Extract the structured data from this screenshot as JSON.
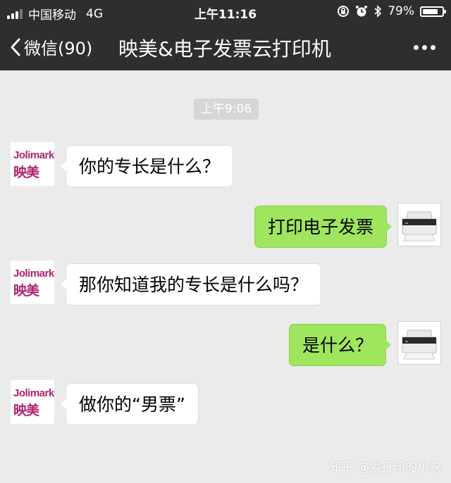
{
  "status_bar": {
    "carrier": "中国移动",
    "network": "4G",
    "time": "上午11:16",
    "battery": "79%",
    "battery_level": 0.79,
    "icons": [
      "signal-icon",
      "rotation-lock-icon",
      "alarm-icon",
      "bluetooth-icon",
      "battery-icon"
    ]
  },
  "nav": {
    "back_label": "微信(90)",
    "title": "映美&电子发票云打印机",
    "more_icon": "more-icon"
  },
  "chat": {
    "timestamp": "上午9:06",
    "avatars": {
      "bot_logo_top": "Jolimark",
      "bot_logo_bottom": "映美",
      "user_avatar": "printer-photo"
    },
    "messages": [
      {
        "side": "left",
        "text": "你的专长是什么？"
      },
      {
        "side": "right",
        "text": "打印电子发票"
      },
      {
        "side": "left",
        "text": "那你知道我的专长是什么吗？"
      },
      {
        "side": "right",
        "text": "是什么？"
      },
      {
        "side": "left",
        "text": "做你的“男票”"
      }
    ]
  },
  "watermark": "知乎 @爱打印的小映",
  "colors": {
    "header_bg": "#2e2e2e",
    "chat_bg": "#ebebeb",
    "bubble_right": "#9fe65e",
    "bubble_left": "#ffffff",
    "brand": "#b0216e"
  }
}
